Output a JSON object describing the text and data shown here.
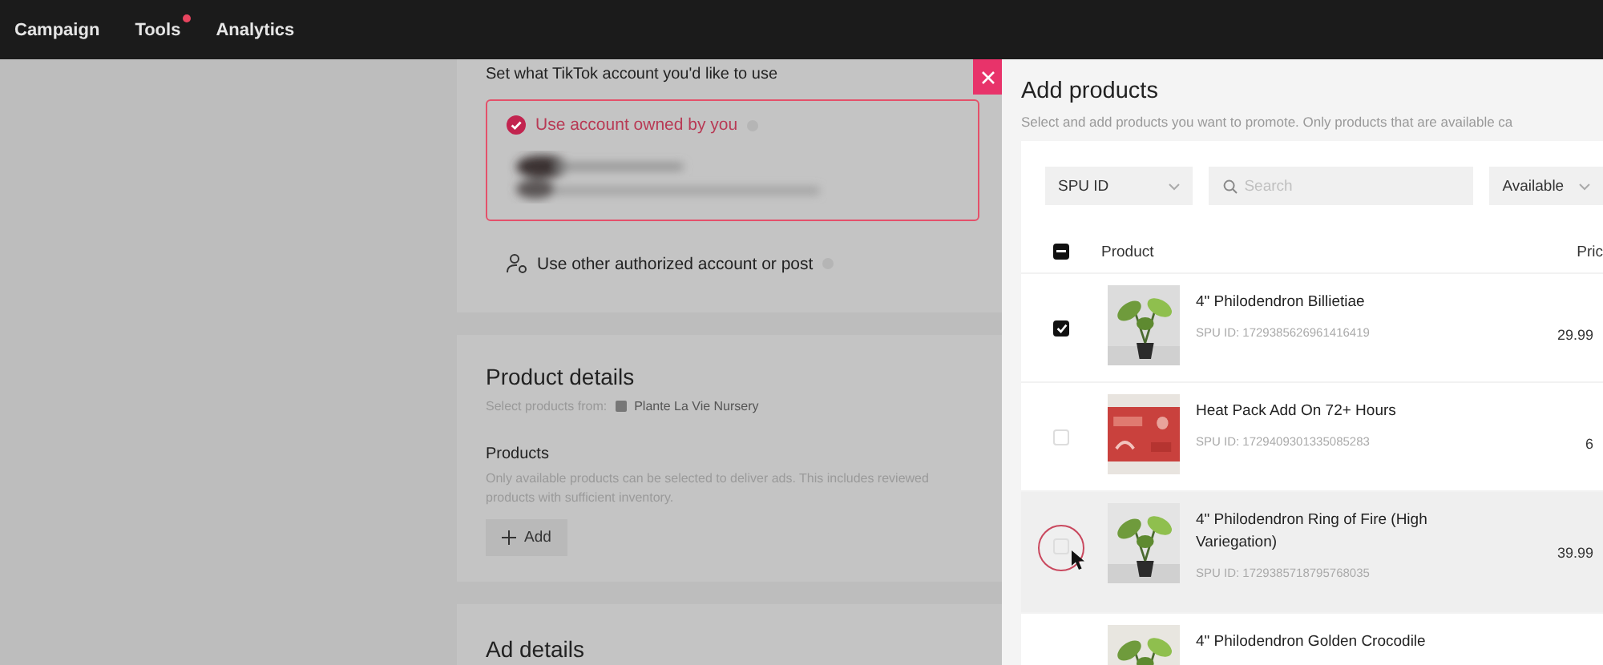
{
  "nav": [
    {
      "label": "Campaign",
      "dot": false
    },
    {
      "label": "Tools",
      "dot": true
    },
    {
      "label": "Analytics",
      "dot": false
    }
  ],
  "account": {
    "prompt": "Set what TikTok account you'd like to use",
    "options": [
      {
        "label": "Use account owned by you",
        "selected": true
      },
      {
        "label": "Use other authorized account or post",
        "selected": false
      }
    ]
  },
  "product_details": {
    "title": "Product details",
    "source_label": "Select products from:",
    "store": "Plante La Vie Nursery",
    "products_label": "Products",
    "products_hint": "Only available products can be selected to deliver ads. This includes reviewed products with sufficient inventory.",
    "add_button": "Add"
  },
  "ad_details": {
    "title": "Ad details"
  },
  "drawer": {
    "title": "Add products",
    "subtitle": "Select and add products you want to promote. Only products that are available ca",
    "id_filter": "SPU ID",
    "search": {
      "placeholder": "Search"
    },
    "status_filter": "Available",
    "columns": [
      "Product",
      "Pric"
    ],
    "select_all_indeterminate": true,
    "rows": [
      {
        "name": "4\" Philodendron Billietiae",
        "spu": "SPU ID: 1729385626961416419",
        "price": "29.99",
        "checked": true,
        "hovered": false
      },
      {
        "name": "Heat Pack Add On 72+ Hours",
        "spu": "SPU ID: 1729409301335085283",
        "price": "6",
        "checked": false,
        "hovered": false
      },
      {
        "name": "4\" Philodendron Ring of Fire (High Variegation)",
        "spu": "SPU ID: 1729385718795768035",
        "price": "39.99",
        "checked": false,
        "hovered": true
      },
      {
        "name": "4\" Philodendron Golden Crocodile",
        "hovered": false
      }
    ]
  }
}
